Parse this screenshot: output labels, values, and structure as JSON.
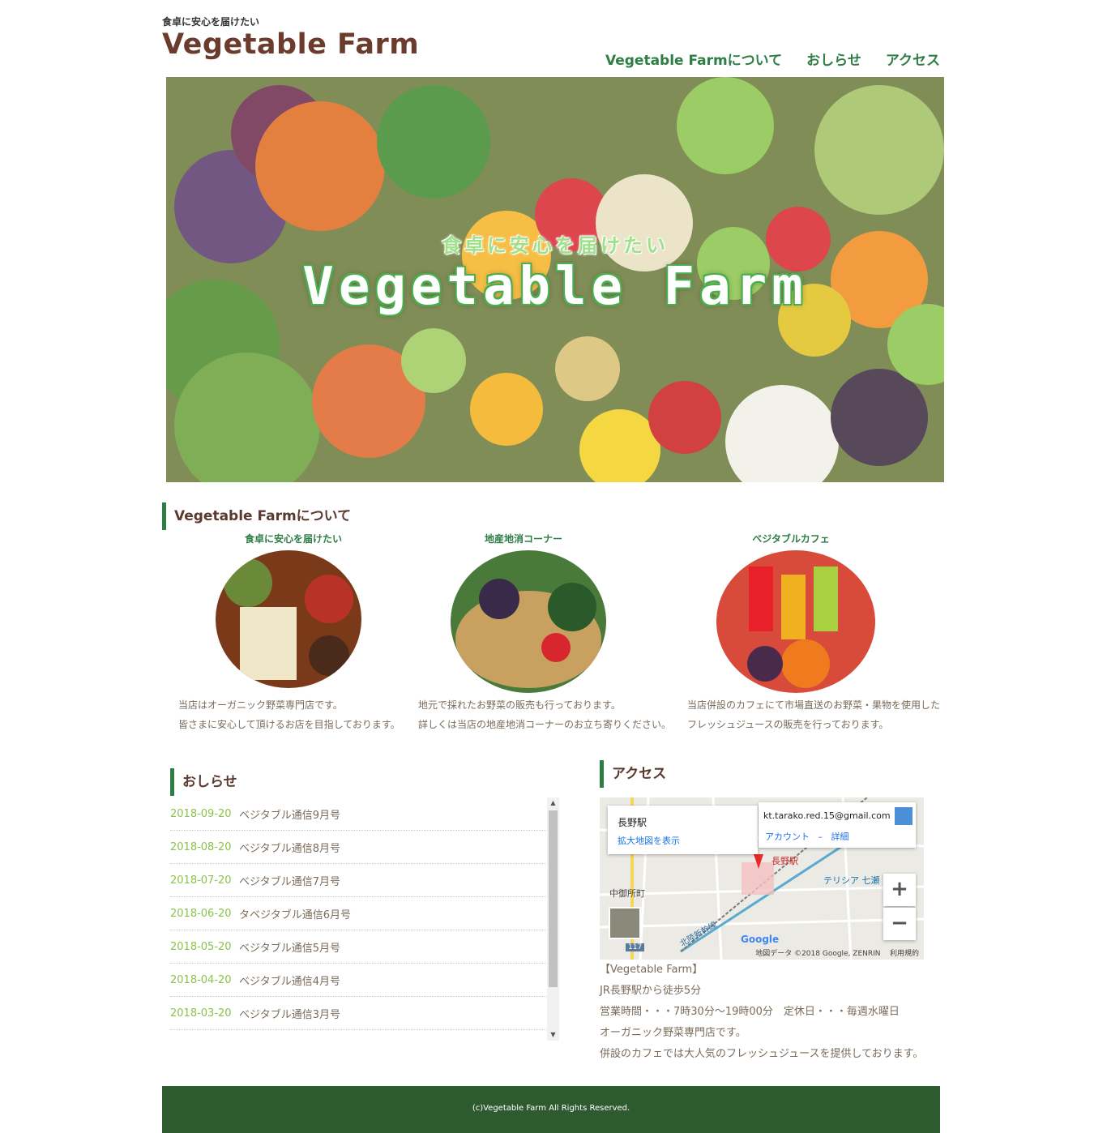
{
  "header": {
    "tagline": "食卓に安心を届けたい",
    "title": "Vegetable Farm",
    "nav": [
      "Vegetable Farmについて",
      "おしらせ",
      "アクセス"
    ]
  },
  "hero": {
    "subtitle": "食卓に安心を届けたい",
    "title": "Vegetable Farm"
  },
  "about": {
    "heading": "Vegetable Farmについて",
    "features": [
      {
        "title": "食卓に安心を届けたい",
        "lines": [
          "当店はオーガニック野菜専門店です。",
          "皆さまに安心して頂けるお店を目指しております。"
        ]
      },
      {
        "title": "地産地消コーナー",
        "lines": [
          "地元で採れたお野菜の販売も行っております。",
          "詳しくは当店の地産地消コーナーのお立ち寄りください。"
        ]
      },
      {
        "title": "ベジタブルカフェ",
        "lines": [
          "当店併設のカフェにて市場直送のお野菜・果物を使用した",
          "フレッシュジュースの販売を行っております。"
        ]
      }
    ]
  },
  "news": {
    "heading": "おしらせ",
    "items": [
      {
        "date": "2018-09-20",
        "title": "ベジタブル通信9月号"
      },
      {
        "date": "2018-08-20",
        "title": "ベジタブル通信8月号"
      },
      {
        "date": "2018-07-20",
        "title": "ベジタブル通信7月号"
      },
      {
        "date": "2018-06-20",
        "title": "タベジタブル通信6月号"
      },
      {
        "date": "2018-05-20",
        "title": "ベジタブル通信5月号"
      },
      {
        "date": "2018-04-20",
        "title": "ベジタブル通信4月号"
      },
      {
        "date": "2018-03-20",
        "title": "ベジタブル通信3月号"
      }
    ]
  },
  "access": {
    "heading": "アクセス",
    "map": {
      "place": "長野駅",
      "enlarge_link": "拡大地図を表示",
      "account_email": "kt.tarako.red.15@gmail.com",
      "account_link": "アカウント",
      "separator": "–",
      "details_link": "詳細",
      "zoom_in": "+",
      "zoom_out": "−",
      "attribution": "地図データ ©2018 Google, ZENRIN",
      "terms": "利用規約",
      "labels": [
        "長野駅",
        "中御所町",
        "テリシア 七瀬",
        "北陸新幹線",
        "Google",
        "117"
      ]
    },
    "lines": [
      "【Vegetable Farm】",
      "JR長野駅から徒歩5分",
      "営業時間・・・7時30分～19時00分　定休日・・・毎週水曜日",
      "オーガニック野菜専門店です。",
      "併設のカフェでは大人気のフレッシュジュースを提供しております。"
    ]
  },
  "footer": {
    "copyright": "(c)Vegetable Farm All Rights Reserved."
  },
  "colors": {
    "brand_green": "#2e7d45",
    "title_brown": "#6b3c2e",
    "date_green": "#8bc34a",
    "footer_bg": "#2e5a30"
  }
}
